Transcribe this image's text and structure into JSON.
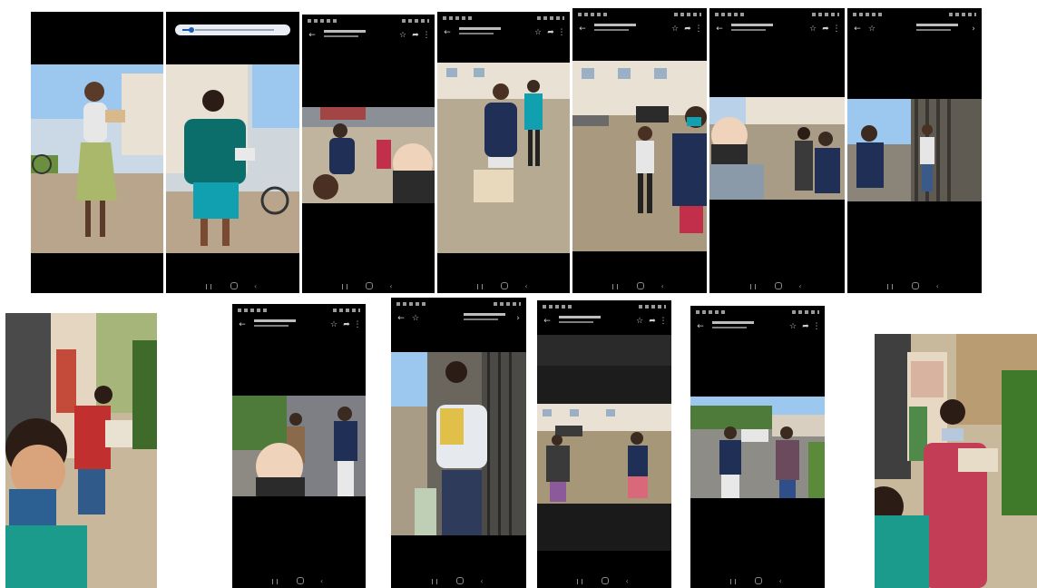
{
  "collage": {
    "photos": [
      {
        "id": "p1",
        "kind": "screenshot",
        "scene": "woman-headscarf-bag"
      },
      {
        "id": "p2",
        "kind": "screenshot-volume",
        "scene": "woman-green-shirt"
      },
      {
        "id": "p3",
        "kind": "screenshot",
        "scene": "group-selfie-mask"
      },
      {
        "id": "p4",
        "kind": "screenshot",
        "scene": "group-boxes"
      },
      {
        "id": "p5",
        "kind": "screenshot",
        "scene": "women-road-selfie"
      },
      {
        "id": "p6",
        "kind": "screenshot",
        "scene": "selfie-group"
      },
      {
        "id": "p7",
        "kind": "screenshot",
        "scene": "woman-door"
      },
      {
        "id": "p8",
        "kind": "photo",
        "scene": "selfie-mural-left"
      },
      {
        "id": "p9",
        "kind": "screenshot",
        "scene": "selfie-street"
      },
      {
        "id": "p10",
        "kind": "screenshot",
        "scene": "woman-bag-door"
      },
      {
        "id": "p11",
        "kind": "screenshot",
        "scene": "group-road"
      },
      {
        "id": "p12",
        "kind": "screenshot",
        "scene": "two-women-street"
      },
      {
        "id": "p13",
        "kind": "photo",
        "scene": "selfie-mural-right"
      }
    ]
  },
  "colors": {
    "sky": "#9cc7ee",
    "ground": "#b9a58b",
    "building": "#e8e1d4",
    "mask": "#2b2b2b",
    "green_shirt": "#0b6e6b",
    "teal_shorts": "#11a0b0",
    "floral": "#c23d55"
  },
  "icons": [
    "back-icon",
    "star-icon",
    "share-icon",
    "more-icon",
    "recents-icon",
    "home-icon",
    "backnav-icon",
    "volume-icon"
  ]
}
